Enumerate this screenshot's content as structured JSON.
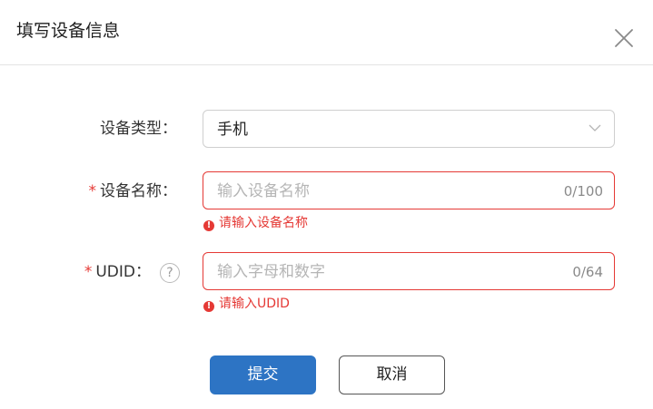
{
  "dialog": {
    "title": "填写设备信息"
  },
  "form": {
    "device_type": {
      "label": "设备类型：",
      "value": "手机"
    },
    "device_name": {
      "required_mark": "*",
      "label": "设备名称：",
      "placeholder": "输入设备名称",
      "counter": "0/100",
      "error": "请输入设备名称"
    },
    "udid": {
      "required_mark": "*",
      "label": "UDID：",
      "help_glyph": "?",
      "placeholder": "输入字母和数字",
      "counter": "0/64",
      "error": "请输入UDID"
    }
  },
  "error_glyph": "!",
  "actions": {
    "submit": "提交",
    "cancel": "取消"
  },
  "colors": {
    "primary": "#2d74c4",
    "error": "#e53935",
    "border": "#cfcfcf"
  },
  "icons": {
    "close": "close-icon",
    "dropdown": "chevron-down-icon",
    "help": "question-circle-icon",
    "error": "error-circle-icon"
  }
}
